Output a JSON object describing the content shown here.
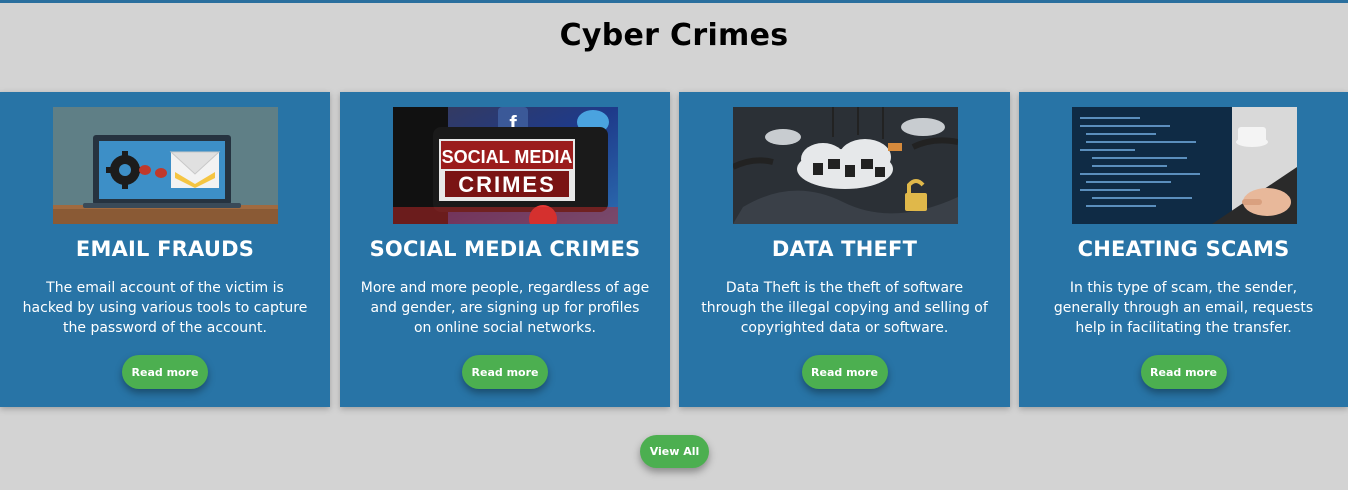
{
  "section": {
    "title": "Cyber Crimes"
  },
  "cards": [
    {
      "title": "EMAIL FRAUDS",
      "description": "The email account of the victim is hacked by using various tools to capture the password of the account.",
      "button_label": "Read more",
      "image_icon": "email-fraud-illustration"
    },
    {
      "title": "SOCIAL MEDIA CRIMES",
      "description": "More and more people, regardless of age and gender, are signing up for profiles on online social networks.",
      "button_label": "Read more",
      "image_icon": "social-media-crimes-photo",
      "image_text_line1": "SOCIAL MEDIA",
      "image_text_line2": "CRIMES"
    },
    {
      "title": "DATA THEFT",
      "description": "Data Theft is the theft of software through the illegal copying and selling of copyrighted data or software.",
      "button_label": "Read more",
      "image_icon": "data-theft-illustration"
    },
    {
      "title": "CHEATING SCAMS",
      "description": "In this type of scam, the sender, generally through an email, requests help in facilitating the transfer.",
      "button_label": "Read more",
      "image_icon": "hacker-laptop-photo"
    }
  ],
  "footer": {
    "view_all_label": "View All"
  },
  "colors": {
    "page_background": "#d3d3d3",
    "card_background": "#2874a6",
    "button_green": "#4caf50",
    "top_border": "#2a6f9e"
  }
}
